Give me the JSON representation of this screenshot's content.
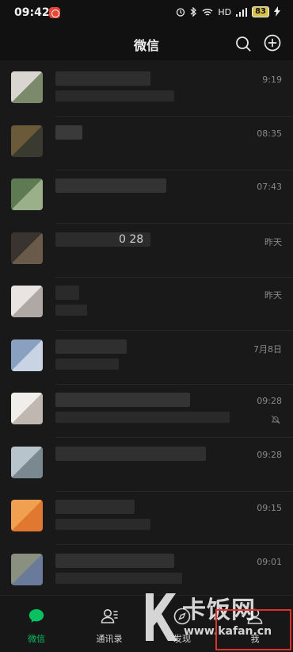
{
  "status_bar": {
    "time": "09:42",
    "signal_text": "HD",
    "battery": "83"
  },
  "navbar": {
    "title": "微信",
    "icons": [
      "search-icon",
      "add-icon"
    ]
  },
  "chats": [
    {
      "time": "9:19",
      "name_visible": "",
      "avatar_colors": [
        "#d9d6d2",
        "#7a8a6a"
      ]
    },
    {
      "time": "08:35",
      "name_visible": "",
      "avatar_colors": [
        "#6a5a3a",
        "#3a3a30"
      ]
    },
    {
      "time": "07:43",
      "name_visible": "",
      "avatar_colors": [
        "#5e7a52",
        "#9ab08a"
      ]
    },
    {
      "time": "昨天",
      "name_visible": "0 28",
      "avatar_colors": [
        "#3a3430",
        "#6a5a4a"
      ]
    },
    {
      "time": "昨天",
      "name_visible": "",
      "avatar_colors": [
        "#e8e4e2",
        "#b0a8a4"
      ]
    },
    {
      "time": "7月8日",
      "name_visible": "",
      "avatar_colors": [
        "#8aa0c0",
        "#c8d4e4"
      ]
    },
    {
      "time": "09:28",
      "name_visible": "",
      "avatar_colors": [
        "#f0eeea",
        "#c0b8b0"
      ],
      "muted": true
    },
    {
      "time": "09:28",
      "name_visible": "",
      "avatar_colors": [
        "#b8c4cc",
        "#7a8890"
      ]
    },
    {
      "time": "09:15",
      "name_visible": "",
      "avatar_colors": [
        "#f0a050",
        "#e07830"
      ]
    },
    {
      "time": "09:01",
      "name_visible": "",
      "avatar_colors": [
        "#8a9080",
        "#6a7a9a"
      ]
    },
    {
      "time": "",
      "name_visible": "",
      "avatar_colors": [
        "#a8b0a8",
        "#d0d4d0"
      ]
    }
  ],
  "tabbar": {
    "tabs": [
      {
        "label": "微信",
        "icon": "chat-bubble-icon",
        "active": true
      },
      {
        "label": "通讯录",
        "icon": "contacts-icon",
        "active": false
      },
      {
        "label": "发现",
        "icon": "compass-icon",
        "active": false
      },
      {
        "label": "我",
        "icon": "person-icon",
        "active": false
      }
    ]
  },
  "watermark": {
    "text": "卡饭网",
    "url": "www.kafan.cn"
  },
  "colors": {
    "accent": "#07c160",
    "background": "#111111",
    "list_background": "#191919"
  }
}
